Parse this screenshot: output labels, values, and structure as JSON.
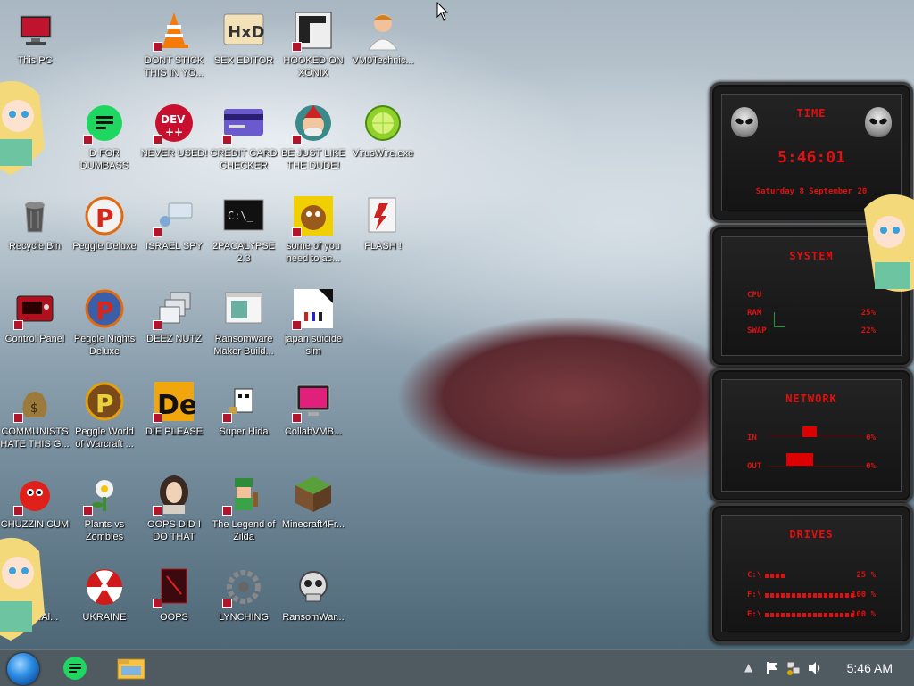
{
  "desktop_icons": [
    {
      "label": "This PC",
      "icon": "monitor-icon"
    },
    {
      "label": "DONT STICK THIS IN YO...",
      "icon": "vlc-cone-icon"
    },
    {
      "label": "SEX EDITOR",
      "icon": "hxd-icon"
    },
    {
      "label": "HOOKED ON XONIX",
      "icon": "xonix-icon"
    },
    {
      "label": "VM0Technic...",
      "icon": "doctor-icon"
    },
    {
      "label": "D FOR DUMBASS",
      "icon": "green-chat-icon"
    },
    {
      "label": "NEVER USED!",
      "icon": "devcpp-icon"
    },
    {
      "label": "CREDIT CARD CHECKER",
      "icon": "credit-card-icon"
    },
    {
      "label": "BE JUST LIKE THE DUDE!",
      "icon": "elf-icon"
    },
    {
      "label": "VirusWire.exe",
      "icon": "lime-icon"
    },
    {
      "label": "Recycle Bin",
      "icon": "recycle-bin-icon"
    },
    {
      "label": "Peggle Deluxe",
      "icon": "peggle-icon"
    },
    {
      "label": "ISRAEL SPY",
      "icon": "network-icon"
    },
    {
      "label": "2PACALYPSE 2.3",
      "icon": "terminal-icon"
    },
    {
      "label": "some of you need to ac...",
      "icon": "dog-icon"
    },
    {
      "label": "FLASH !",
      "icon": "flash-icon"
    },
    {
      "label": "Control Panel",
      "icon": "control-panel-icon"
    },
    {
      "label": "Peggle Nights Deluxe",
      "icon": "peggle-nights-icon"
    },
    {
      "label": "DEEZ NUTZ",
      "icon": "windows-stack-icon"
    },
    {
      "label": "Ransomware Maker Build...",
      "icon": "window-app-icon"
    },
    {
      "label": "japan suicide sim",
      "icon": "japan-sim-icon"
    },
    {
      "label": "COMMUNISTS HATE THIS G...",
      "icon": "money-bag-icon"
    },
    {
      "label": "Peggle World of Warcraft ...",
      "icon": "peggle-wow-icon"
    },
    {
      "label": "DIE PLEASE",
      "icon": "de-icon"
    },
    {
      "label": "Super Hida",
      "icon": "pixel-cat-icon"
    },
    {
      "label": "CollabVMB...",
      "icon": "pink-monitor-icon"
    },
    {
      "label": "CHUZZIN CUM",
      "icon": "chuzzle-icon"
    },
    {
      "label": "Plants vs Zombies",
      "icon": "flower-icon"
    },
    {
      "label": "OOPS DID I DO THAT",
      "icon": "portrait-icon"
    },
    {
      "label": "The Legend of Zilda",
      "icon": "pixel-hero-icon"
    },
    {
      "label": "Minecraft4Fr...",
      "icon": "grass-block-icon"
    },
    {
      "label": "...ad ...Al...",
      "icon": "partial-icon"
    },
    {
      "label": "UKRAINE",
      "icon": "radiation-icon"
    },
    {
      "label": "OOPS",
      "icon": "red-box-icon"
    },
    {
      "label": "LYNCHING",
      "icon": "gear-rope-icon"
    },
    {
      "label": "RansomWar...",
      "icon": "skull-icon"
    }
  ],
  "gadgets": {
    "time": {
      "title": "TIME",
      "clock": "5:46:01",
      "date": "Saturday 8 September 20"
    },
    "system": {
      "title": "SYSTEM",
      "rows": [
        {
          "label": "CPU",
          "value": ""
        },
        {
          "label": "RAM",
          "value": "25%"
        },
        {
          "label": "SWAP",
          "value": "22%"
        }
      ]
    },
    "network": {
      "title": "NETWORK",
      "rows": [
        {
          "label": "IN",
          "value": "0%"
        },
        {
          "label": "OUT",
          "value": "0%"
        }
      ]
    },
    "drives": {
      "title": "DRIVES",
      "rows": [
        {
          "label": "C:\\",
          "value": "25 %"
        },
        {
          "label": "F:\\",
          "value": "100 %"
        },
        {
          "label": "E:\\",
          "value": "100 %"
        }
      ]
    }
  },
  "taskbar": {
    "clock": "5:46 AM"
  },
  "colors": {
    "gadget_red": "#e01010",
    "taskbar": "#505a61"
  }
}
